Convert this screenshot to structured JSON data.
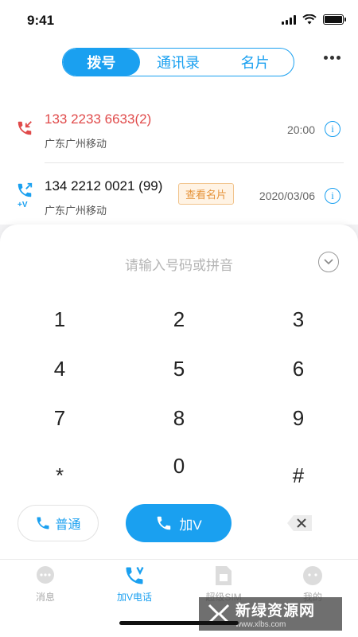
{
  "status": {
    "time": "9:41"
  },
  "tabs": [
    {
      "label": "拨号",
      "active": true
    },
    {
      "label": "通讯录",
      "active": false
    },
    {
      "label": "名片",
      "active": false
    }
  ],
  "calls": [
    {
      "number": "133 2233 6633(2)",
      "location": "广东广州移动",
      "time": "20:00",
      "type": "missed",
      "number_color": "#e04a4a"
    },
    {
      "number": "134 2212 0021 (99)",
      "location": "广东广州移动",
      "time": "2020/03/06",
      "type": "outgoing-v",
      "badge": "查看名片",
      "v_label": "+V"
    }
  ],
  "dialpad": {
    "placeholder": "请输入号码或拼音",
    "keys": [
      "1",
      "2",
      "3",
      "4",
      "5",
      "6",
      "7",
      "8",
      "9",
      "*",
      "0",
      "#"
    ],
    "normal_label": "普通",
    "call_label": "加V"
  },
  "tabbar": [
    {
      "label": "消息",
      "icon": "message-icon",
      "active": false
    },
    {
      "label": "加V电话",
      "icon": "phone-v-icon",
      "active": true
    },
    {
      "label": "超级SIM",
      "icon": "sim-icon",
      "active": false
    },
    {
      "label": "我的",
      "icon": "profile-icon",
      "active": false
    }
  ],
  "watermark": {
    "title": "新绿资源网",
    "url": "www.xlbs.com"
  },
  "colors": {
    "accent": "#1aa0f0",
    "missed": "#e04a4a",
    "badge": "#e6933a"
  }
}
